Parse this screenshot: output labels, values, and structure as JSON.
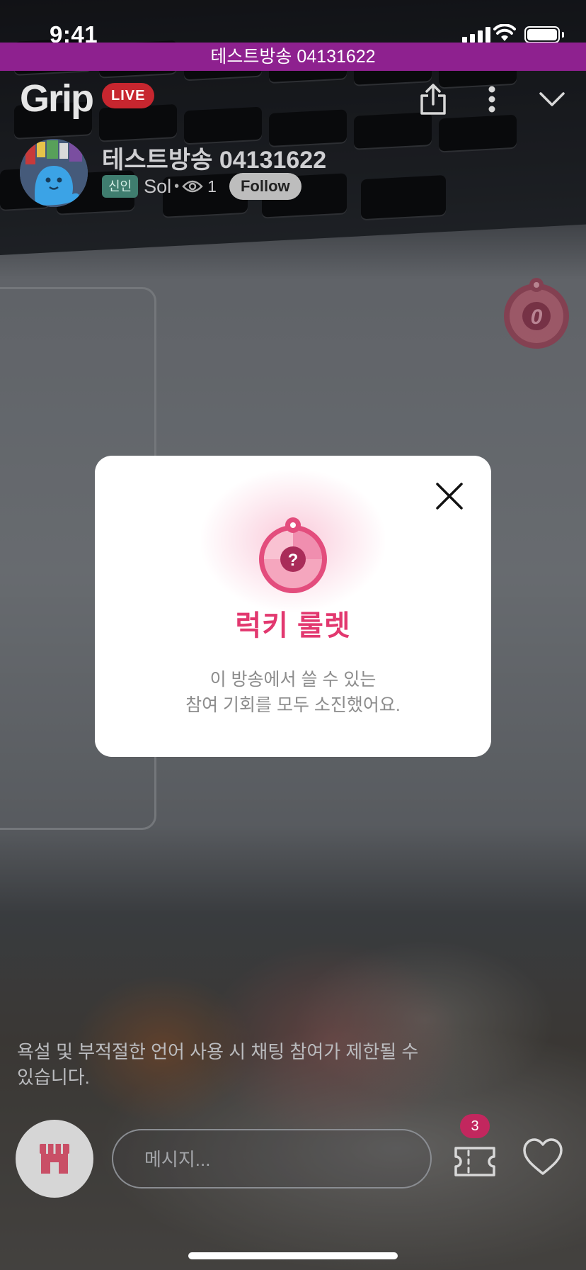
{
  "status_bar": {
    "time": "9:41"
  },
  "banner": {
    "text": "테스트방송 04131622"
  },
  "header": {
    "logo": "Grip",
    "live_badge": "LIVE",
    "share_icon": "share-icon",
    "more_icon": "more-vertical-icon",
    "collapse_icon": "chevron-down-icon"
  },
  "host": {
    "title": "테스트방송 04131622",
    "badge": "신인",
    "name": "Sol",
    "separator": "•",
    "viewer_count": "1",
    "follow_label": "Follow"
  },
  "roulette_float": {
    "count": "0"
  },
  "modal": {
    "title": "럭키 룰렛",
    "message_line1": "이 방송에서 쓸 수 있는",
    "message_line2": "참여 기회를 모두 소진했어요.",
    "wheel_symbol": "?"
  },
  "chat": {
    "notice": "욕설 및 부적절한 언어 사용 시 채팅 참여가 제한될 수 있습니다."
  },
  "bottom": {
    "message_placeholder": "메시지...",
    "coupon_count": "3"
  },
  "colors": {
    "accent": "#e2386f",
    "banner": "#8e218f",
    "live": "#c7262f"
  }
}
